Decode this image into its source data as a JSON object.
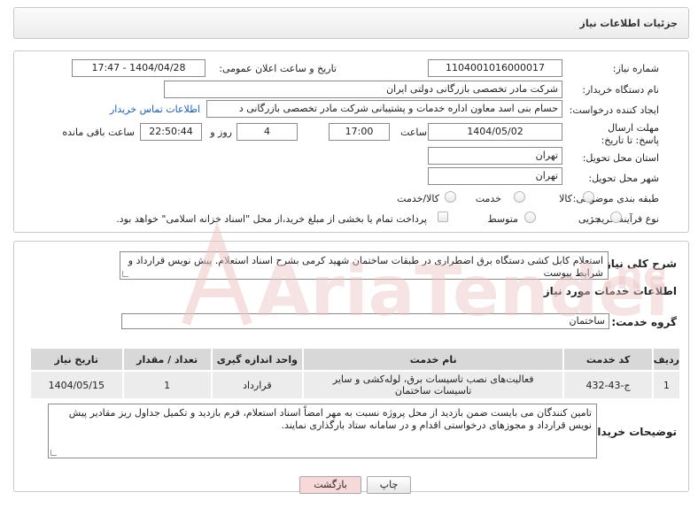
{
  "header": {
    "title": "جزئیات اطلاعات نیاز"
  },
  "form": {
    "need_number_label": "شماره نیاز:",
    "need_number": "1104001016000017",
    "announce_label": "تاریخ و ساعت اعلان عمومی:",
    "announce_value": "1404/04/28 - 17:47",
    "buyer_org_label": "نام دستگاه خریدار:",
    "buyer_org": "شرکت مادر تخصصی بازرگانی دولتی ایران",
    "requester_label": "ایجاد کننده درخواست:",
    "requester": "حسام بنی اسد معاون اداره خدمات و پشتیبانی شرکت مادر تخصصی بازرگانی د",
    "contact_link": "اطلاعات تماس خریدار",
    "deadline_label": "مهلت ارسال پاسخ: تا تاریخ:",
    "deadline_date": "1404/05/02",
    "time_label": "ساعت",
    "deadline_time": "17:00",
    "days_value": "4",
    "days_label": "روز و",
    "remaining_time": "22:50:44",
    "remaining_label": "ساعت باقی مانده",
    "province_label": "استان محل تحویل:",
    "province": "تهران",
    "city_label": "شهر محل تحویل:",
    "city": "تهران",
    "category_label": "طبقه بندی موضوعی:",
    "category_options": [
      "کالا",
      "خدمت",
      "کالا/خدمت"
    ],
    "process_label": "نوع فرآیند خرید :",
    "process_options": [
      "جزیی",
      "متوسط"
    ],
    "payment_note": "پرداخت تمام یا بخشی از مبلغ خرید،از محل \"اسناد خزانه اسلامی\" خواهد بود."
  },
  "description": {
    "label": "شرح کلی نیاز:",
    "text": "استعلام کابل کشی دستگاه برق اضطراری در طبقات ساختمان شهید کرمی بشرح اسناد استعلام. پیش نویس قرارداد و شرایط پیوست"
  },
  "services": {
    "section_title": "اطلاعات خدمات مورد نیاز",
    "group_label": "گروه خدمت:",
    "group_value": "ساختمان",
    "columns": [
      "ردیف",
      "کد خدمت",
      "نام خدمت",
      "واحد اندازه گیری",
      "تعداد / مقدار",
      "تاریخ نیاز"
    ],
    "rows": [
      {
        "row": "1",
        "code": "ج-43-432",
        "name": "فعالیت‌های نصب تاسیسات برق، لوله‌کشی و سایر تاسیسات ساختمان",
        "unit": "قرارداد",
        "qty": "1",
        "date": "1404/05/15"
      }
    ]
  },
  "buyer_notes": {
    "label": "توضیحات خریدار:",
    "text": "تامین کنندگان می بایست ضمن بازدید از محل پروژه نسبت به مهر امضاً اسناد استعلام، فرم بازدید و تکمیل جداول ریز مقادیر پیش نویس قرارداد و مجوزهای درخواستی اقدام و در سامانه ستاد بارگذاری نمایند."
  },
  "buttons": {
    "print": "چاپ",
    "back": "بازگشت"
  },
  "colors": {
    "accent_link": "#1a5fb4",
    "back_button": "#f7d9d9",
    "watermark": "#e8b4b4"
  }
}
